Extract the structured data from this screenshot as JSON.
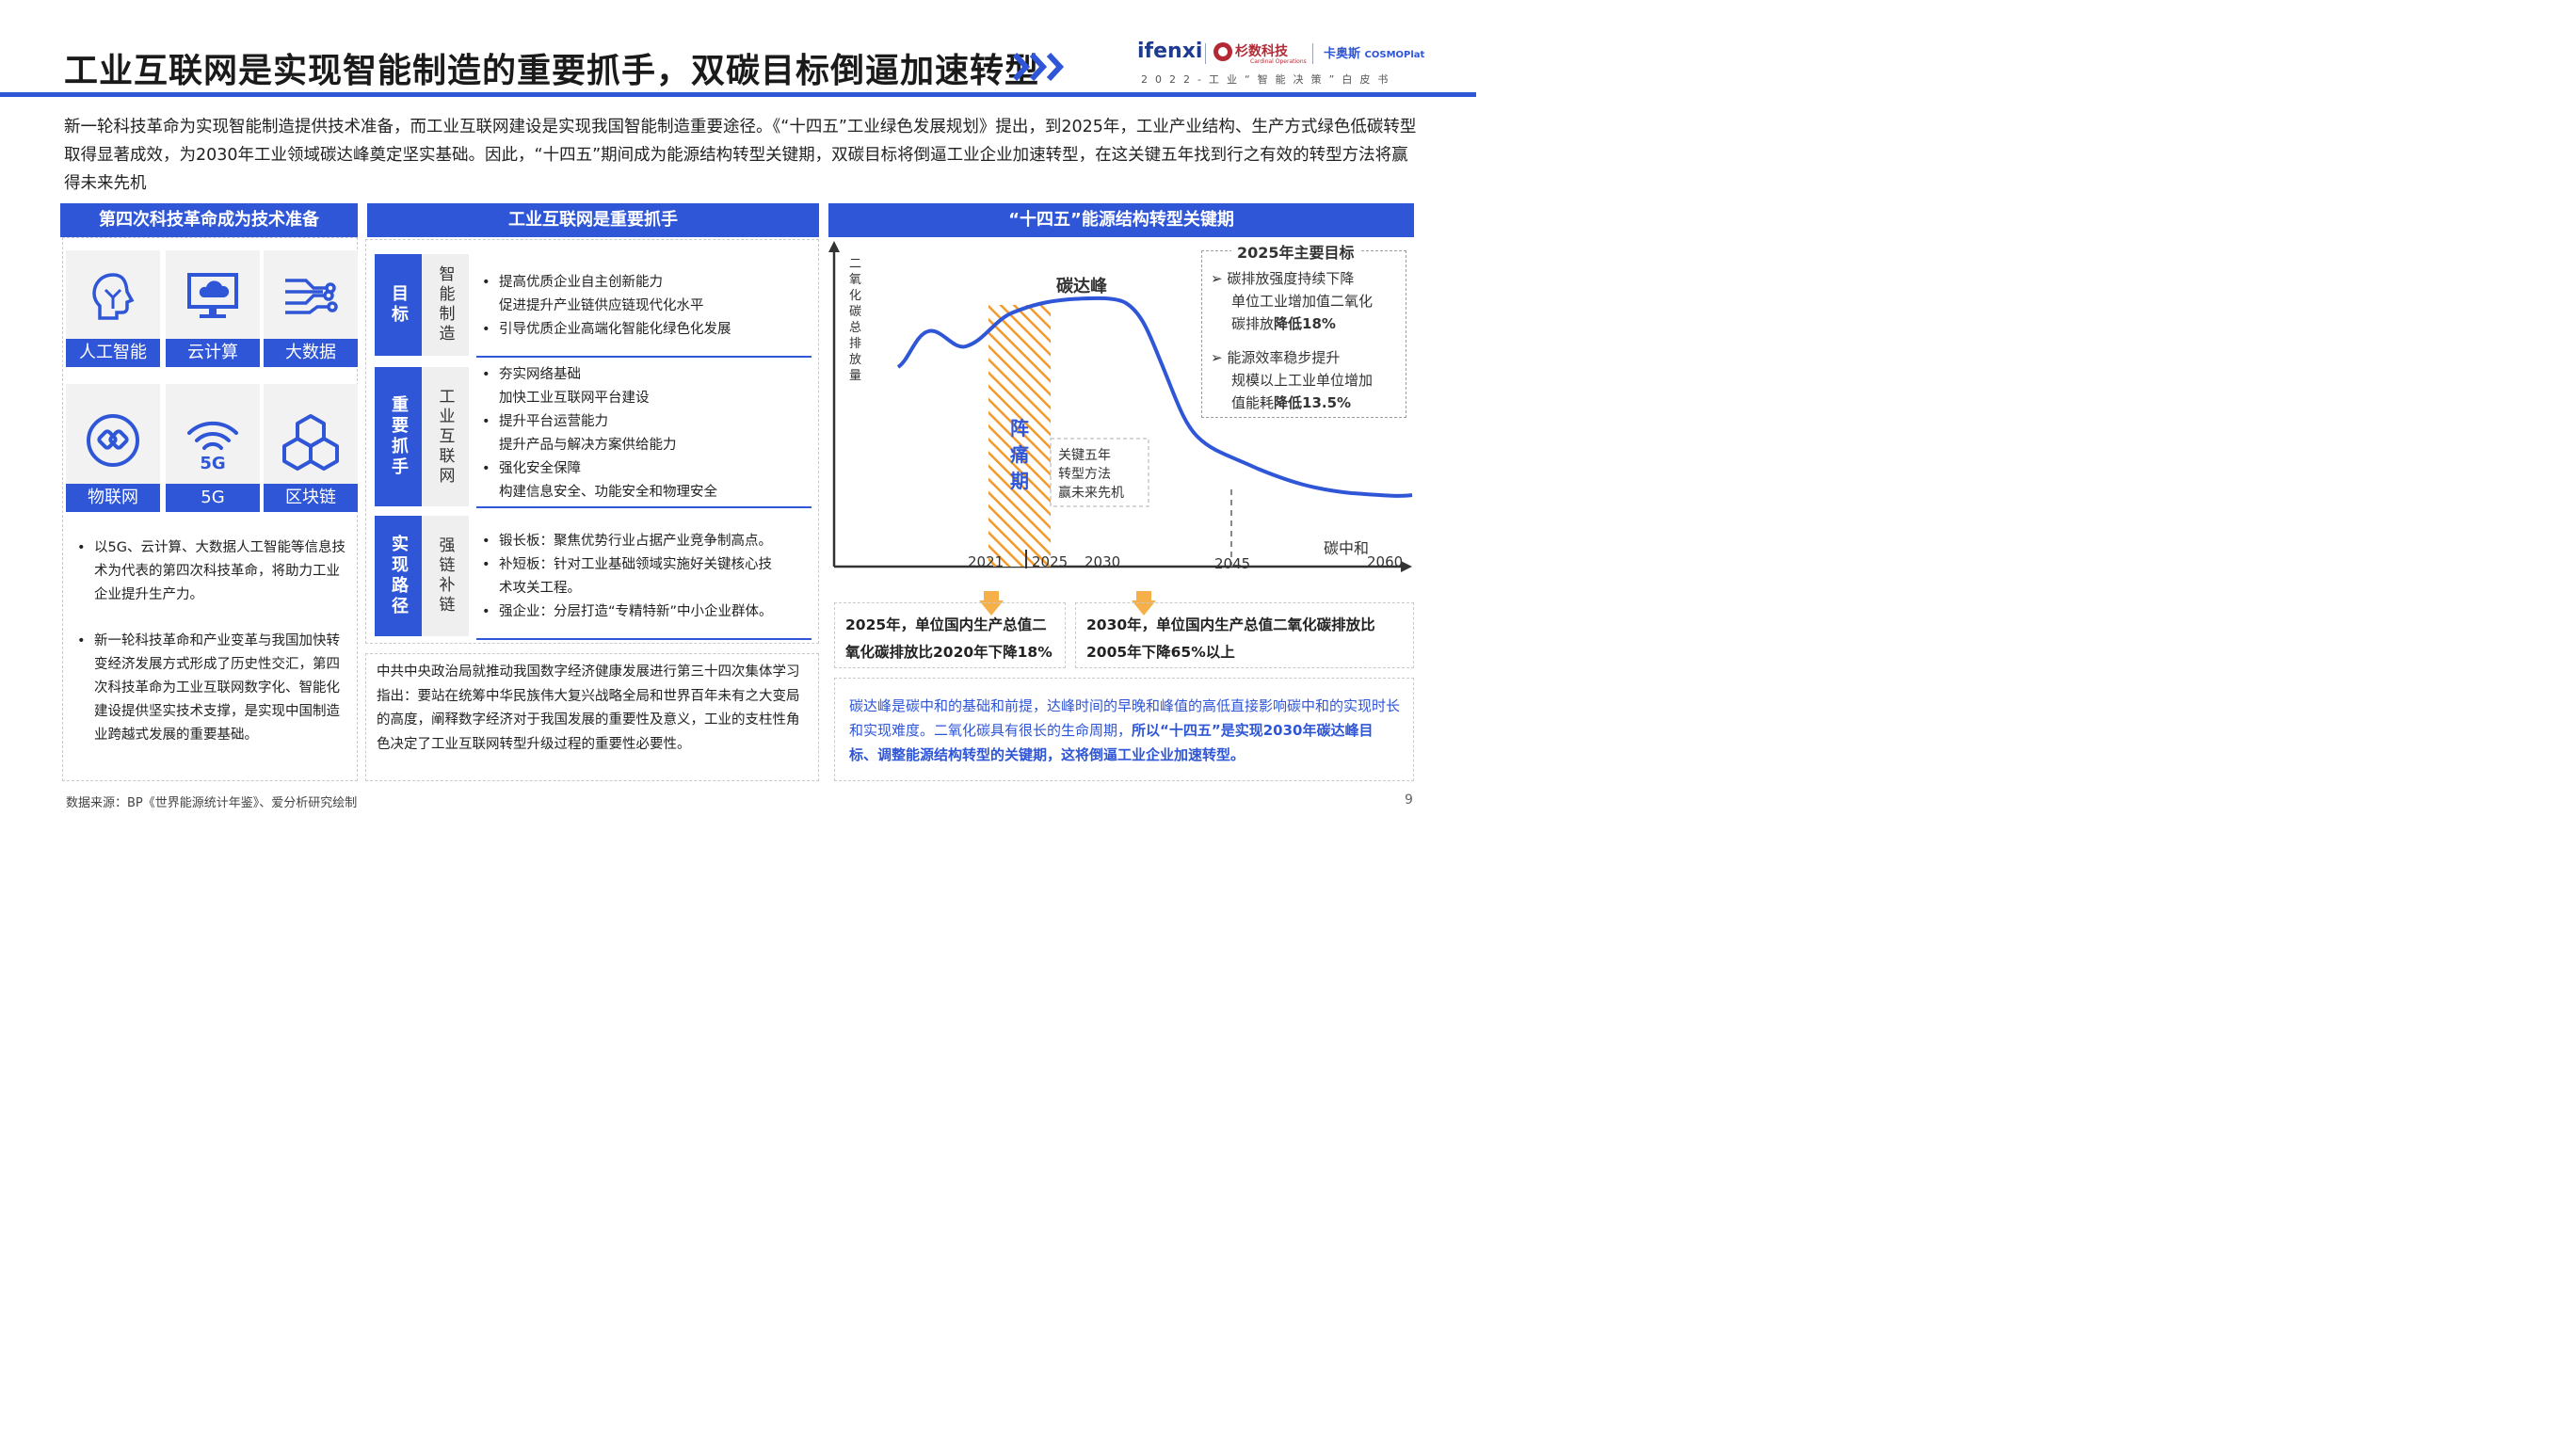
{
  "header": {
    "title": "工业互联网是实现智能制造的重要抓手，双碳目标倒逼加速转型",
    "subtitle": "2022-工业“智能决策”白皮书",
    "logos": {
      "ifenxi": "ifenxi",
      "shanshu": "杉数科技",
      "shanshu_sub": "Cardinal Operations",
      "kaos": "卡奥斯",
      "cosmo": "COSMOPlat"
    }
  },
  "intro": "新一轮科技革命为实现智能制造提供技术准备，而工业互联网建设是实现我国智能制造重要途径。《“十四五”工业绿色发展规划》提出，到2025年，工业产业结构、生产方式绿色低碳转型取得显著成效，为2030年工业领域碳达峰奠定坚实基础。因此，“十四五”期间成为能源结构转型关键期，双碳目标将倒逼工业企业加速转型，在这关键五年找到行之有效的转型方法将赢得未来先机",
  "left": {
    "heading": "第四次科技革命成为技术准备",
    "tiles": [
      {
        "label": "人工智能",
        "icon": "ai-head-icon"
      },
      {
        "label": "云计算",
        "icon": "cloud-monitor-icon"
      },
      {
        "label": "大数据",
        "icon": "data-circuit-icon"
      },
      {
        "label": "物联网",
        "icon": "iot-icon"
      },
      {
        "label": "5G",
        "icon": "5g-signal-icon"
      },
      {
        "label": "区块链",
        "icon": "blockchain-icon"
      }
    ],
    "bullets": [
      "以5G、云计算、大数据人工智能等信息技术为代表的第四次科技革命，将助力工业企业提升生产力。",
      "新一轮科技革命和产业变革与我国加快转变经济发展方式形成了历史性交汇，第四次科技革命为工业互联网数字化、智能化建设提供坚实技术支撑，是实现中国制造业跨越式发展的重要基础。"
    ]
  },
  "middle": {
    "heading": "工业互联网是重要抓手",
    "rows": [
      {
        "label": "目标",
        "sub": "智能制造",
        "items": [
          {
            "text": "提高优质企业自主创新能力",
            "cont": "促进提升产业链供应链现代化水平"
          },
          {
            "text": "引导优质企业高端化智能化绿色化发展",
            "cont": ""
          }
        ]
      },
      {
        "label": "重要抓手",
        "sub": "工业互联网",
        "items": [
          {
            "text": "夯实网络基础",
            "cont": "加快工业互联网平台建设"
          },
          {
            "text": "提升平台运营能力",
            "cont": "提升产品与解决方案供给能力"
          },
          {
            "text": "强化安全保障",
            "cont": "构建信息安全、功能安全和物理安全"
          }
        ]
      },
      {
        "label": "实现路径",
        "sub": "强链补链",
        "items": [
          {
            "text": "锻长板：聚焦优势行业占据产业竞争制高点。",
            "cont": ""
          },
          {
            "text": "补短板：针对工业基础领域实施好关键核心技",
            "cont": "术攻关工程。"
          },
          {
            "text": "强企业：分层打造“专精特新”中小企业群体。",
            "cont": ""
          }
        ]
      }
    ],
    "quote": "中共中央政治局就推动我国数字经济健康发展进行第三十四次集体学习指出：要站在统筹中华民族伟大复兴战略全局和世界百年未有之大变局的高度，阐释数字经济对于我国发展的重要性及意义，工业的支柱性角色决定了工业互联网转型升级过程的重要性必要性。"
  },
  "right": {
    "heading": "“十四五”能源结构转型关键期",
    "chart": {
      "y_label": "二氧化碳总排放量",
      "peak_label": "碳达峰",
      "pain_label": "阵痛期",
      "note_lines": [
        "关键五年",
        "转型方法",
        "赢未来先机"
      ],
      "neutral_label": "碳中和",
      "ticks": [
        "2021",
        "2025",
        "2030",
        "2045",
        "2060"
      ],
      "accent": "#2f56d6",
      "hatch": "#f39a2b"
    },
    "goals": {
      "title": "2025年主要目标",
      "items": [
        {
          "head": "碳排放强度持续下降",
          "l1": "单位工业增加值二氧化",
          "l2a": "碳排放",
          "l2b": "降低18%"
        },
        {
          "head": "能源效率稳步提升",
          "l1": "规模以上工业单位增加",
          "l2a": "值能耗",
          "l2b": "降低13.5%"
        }
      ]
    },
    "stats": [
      "2025年，单位国内生产总值二氧化碳排放比2020年下降18%",
      "2030年，单位国内生产总值二氧化碳排放比2005年下降65%以上"
    ],
    "conclusion_a": "碳达峰是碳中和的基础和前提，达峰时间的早晚和峰值的高低直接影响碳中和的实现时长和实现难度。二氧化碳具有很长的生命周期，",
    "conclusion_b": "所以“十四五”是实现2030年碳达峰目标、调整能源结构转型的关键期，这将倒逼工业企业加速转型。"
  },
  "footer": {
    "source": "数据来源：BP《世界能源统计年鉴》、爱分析研究绘制",
    "page": "9"
  }
}
